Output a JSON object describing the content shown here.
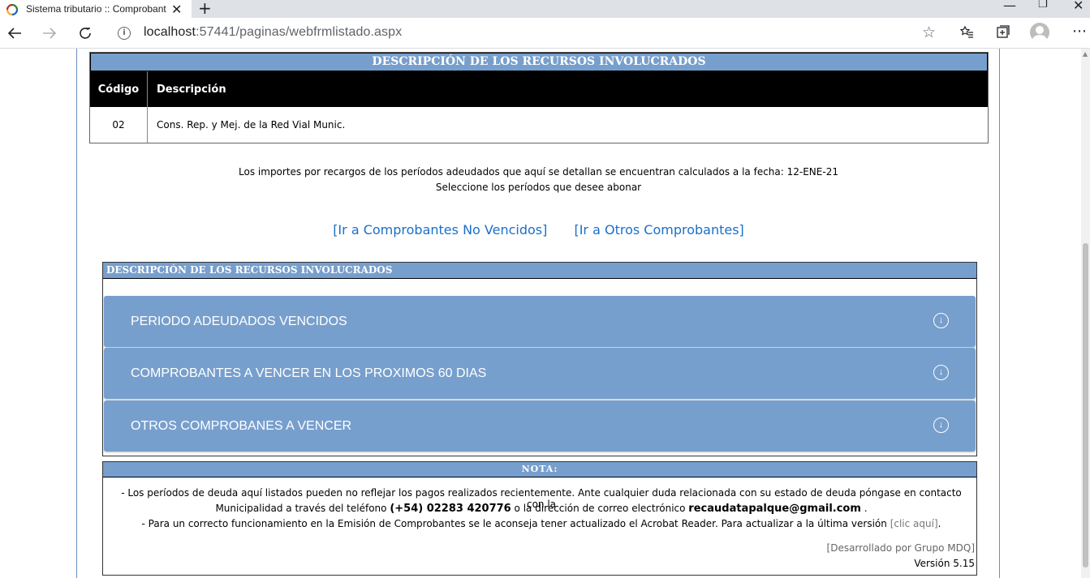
{
  "browser": {
    "tab_title": "Sistema tributario :: Comprobant",
    "url_host": "localhost",
    "url_path": ":57441/paginas/webfrmlistado.aspx"
  },
  "resources_table": {
    "header": "DESCRIPCIÓN DE LOS RECURSOS INVOLUCRADOS",
    "columns": [
      "Código",
      "Descripción"
    ],
    "rows": [
      {
        "code": "02",
        "description": "Cons. Rep. y Mej. de la Red Vial Munic."
      }
    ]
  },
  "info": {
    "line1": "Los importes por recargos de los períodos adeudados que aquí se detallan se encuentran calculados a la fecha: 12-ENE-21",
    "line2": "Seleccione los períodos que desee abonar"
  },
  "links": {
    "no_vencidos": "[Ir a Comprobantes No Vencidos]",
    "otros": "[Ir a Otros Comprobantes]"
  },
  "accordion_box": {
    "header": "DESCRIPCIÓN DE LOS RECURSOS INVOLUCRADOS",
    "items": [
      "PERIODO ADEUDADOS VENCIDOS",
      "COMPROBANTES A VENCER EN LOS PROXIMOS 60 DIAS",
      "OTROS COMPROBANES A VENCER"
    ]
  },
  "nota": {
    "header": "NOTA:",
    "line1": "- Los períodos de deuda aquí listados pueden no reflejar los pagos realizados recientemente. Ante cualquier duda relacionada con su estado de deuda  póngase en contacto con la",
    "line2_pre": "Municipalidad a través del teléfono ",
    "phone": "(+54) 02283 420776",
    "line2_mid": "  o la dirección de correo electrónico ",
    "email": "recaudatapalque@gmail.com",
    "line2_post": " .",
    "line3_pre": "- Para un correcto funcionamiento en la Emisión de Comprobantes se le aconseja tener actualizado el Acrobat Reader. Para actualizar a la última versión ",
    "line3_link": "[clic aquí]",
    "line3_post": ".",
    "credit": "[Desarrollado por Grupo MDQ]",
    "version": "Versión 5.15"
  }
}
